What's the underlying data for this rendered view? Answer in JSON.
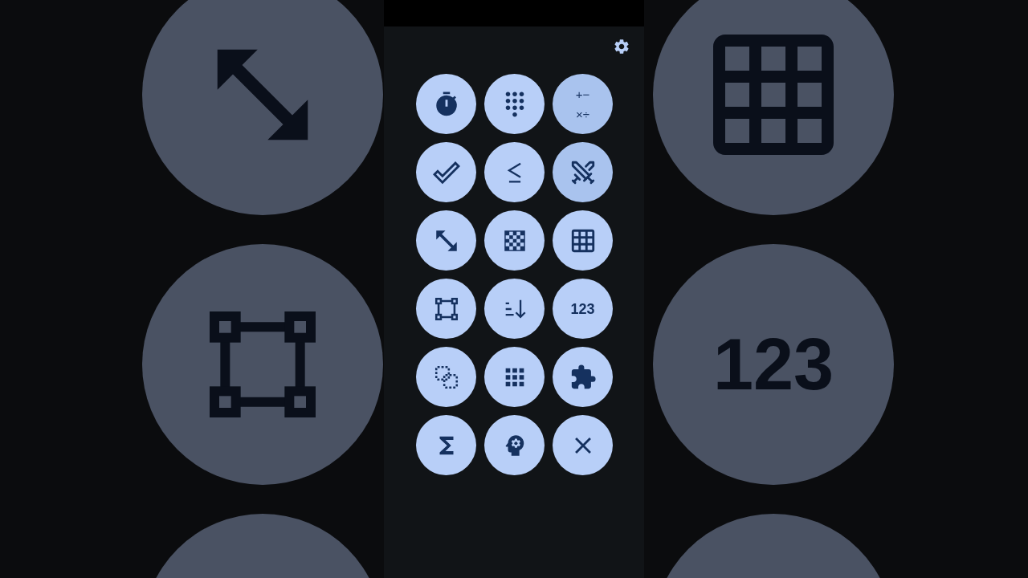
{
  "buttons": [
    {
      "kind": "icon",
      "selected": false
    },
    {
      "kind": "icon",
      "selected": false
    },
    {
      "kind": "text",
      "lines": [
        "+−",
        "×÷"
      ],
      "selected": true
    },
    {
      "kind": "icon",
      "selected": false
    },
    {
      "kind": "icon",
      "selected": false
    },
    {
      "kind": "icon",
      "selected": true
    },
    {
      "kind": "icon",
      "selected": false
    },
    {
      "kind": "icon",
      "selected": false
    },
    {
      "kind": "icon",
      "selected": false
    },
    {
      "kind": "icon",
      "selected": false
    },
    {
      "kind": "icon",
      "selected": false
    },
    {
      "kind": "text",
      "lines": [
        "123"
      ],
      "selected": false
    },
    {
      "kind": "icon",
      "selected": false
    },
    {
      "kind": "icon",
      "selected": false
    },
    {
      "kind": "icon",
      "selected": false
    },
    {
      "kind": "icon",
      "selected": false
    },
    {
      "kind": "icon",
      "selected": false
    },
    {
      "kind": "icon",
      "selected": false
    }
  ],
  "backdrop": {
    "label": "123"
  }
}
